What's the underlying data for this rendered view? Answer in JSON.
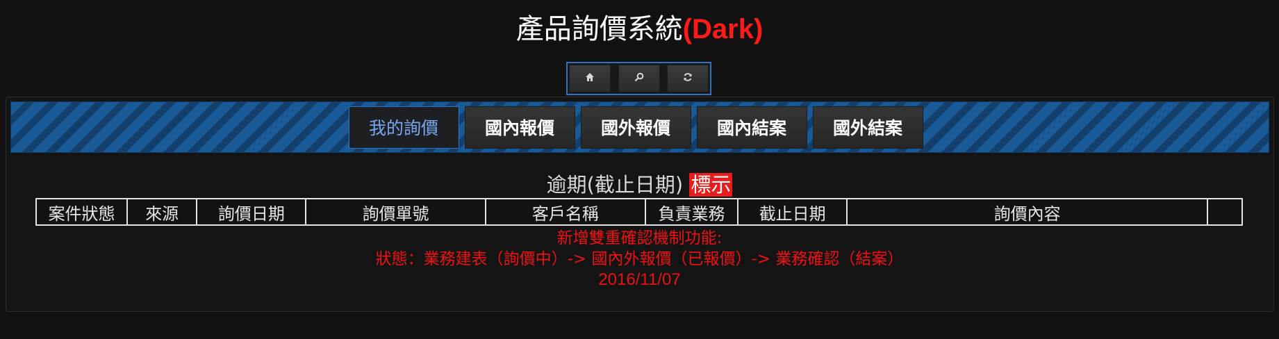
{
  "header": {
    "title_main": "產品詢價系統",
    "title_accent": "(Dark)"
  },
  "toolbar": {
    "buttons": [
      {
        "icon": "home-icon",
        "glyph": "🏠︎"
      },
      {
        "icon": "search-icon",
        "glyph": "⚲"
      },
      {
        "icon": "refresh-icon",
        "glyph": "⟳"
      }
    ]
  },
  "tabs": [
    {
      "label": "我的詢價",
      "active": true
    },
    {
      "label": "國內報價",
      "active": false
    },
    {
      "label": "國外報價",
      "active": false
    },
    {
      "label": "國內結案",
      "active": false
    },
    {
      "label": "國外結案",
      "active": false
    }
  ],
  "legend": {
    "text": "逾期(截止日期)",
    "tag": "標示"
  },
  "table": {
    "columns": [
      "案件狀態",
      "來源",
      "詢價日期",
      "詢價單號",
      "客戶名稱",
      "負責業務",
      "截止日期",
      "詢價內容",
      ""
    ]
  },
  "notice": {
    "line1": "新增雙重確認機制功能:",
    "line2": "狀態：業務建表（詢價中）-> 國內外報價（已報價）-> 業務確認（結案）",
    "date": "2016/11/07"
  },
  "colors": {
    "accent_red": "#ff1a1a",
    "tab_bar_blue": "#174f86",
    "active_tab_text": "#77a8ef",
    "notice_red": "#ee1111"
  }
}
